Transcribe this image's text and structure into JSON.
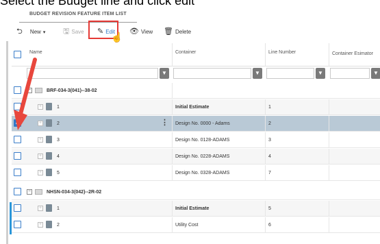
{
  "caption": "Select the Budget line and click edit",
  "tab_title": "BUDGET REVISION FEATURE ITEM LIST",
  "toolbar": {
    "new_label": "New",
    "save_label": "Save",
    "edit_label": "Edit",
    "view_label": "View",
    "delete_label": "Delete"
  },
  "columns": {
    "name": "Name",
    "container": "Container",
    "line_number": "Line Number",
    "container_estimator": "Container Esimator"
  },
  "groups": [
    {
      "name": "BRF-034-3(041)--38-02",
      "rows": [
        {
          "id": "1",
          "container": "Initial Estimate",
          "line": "1"
        },
        {
          "id": "2",
          "container": "Design No. 0000 - Adams",
          "line": "2"
        },
        {
          "id": "3",
          "container": "Design No. 0128-ADAMS",
          "line": "3"
        },
        {
          "id": "4",
          "container": "Design No. 0228-ADAMS",
          "line": "4"
        },
        {
          "id": "5",
          "container": "Design No. 0328-ADAMS",
          "line": "7"
        }
      ]
    },
    {
      "name": "NHSN-034-3(042)--2R-02",
      "rows": [
        {
          "id": "1",
          "container": "Initial Estimate",
          "line": "5"
        },
        {
          "id": "2",
          "container": "Utility Cost",
          "line": "6"
        }
      ]
    }
  ],
  "colors": {
    "selected_row": "#b9c9d6",
    "checkbox_blue": "#2f77c7",
    "highlight_red": "#e53935",
    "arrow_red": "#e8473d",
    "accent_bar": "#2a96d9"
  }
}
